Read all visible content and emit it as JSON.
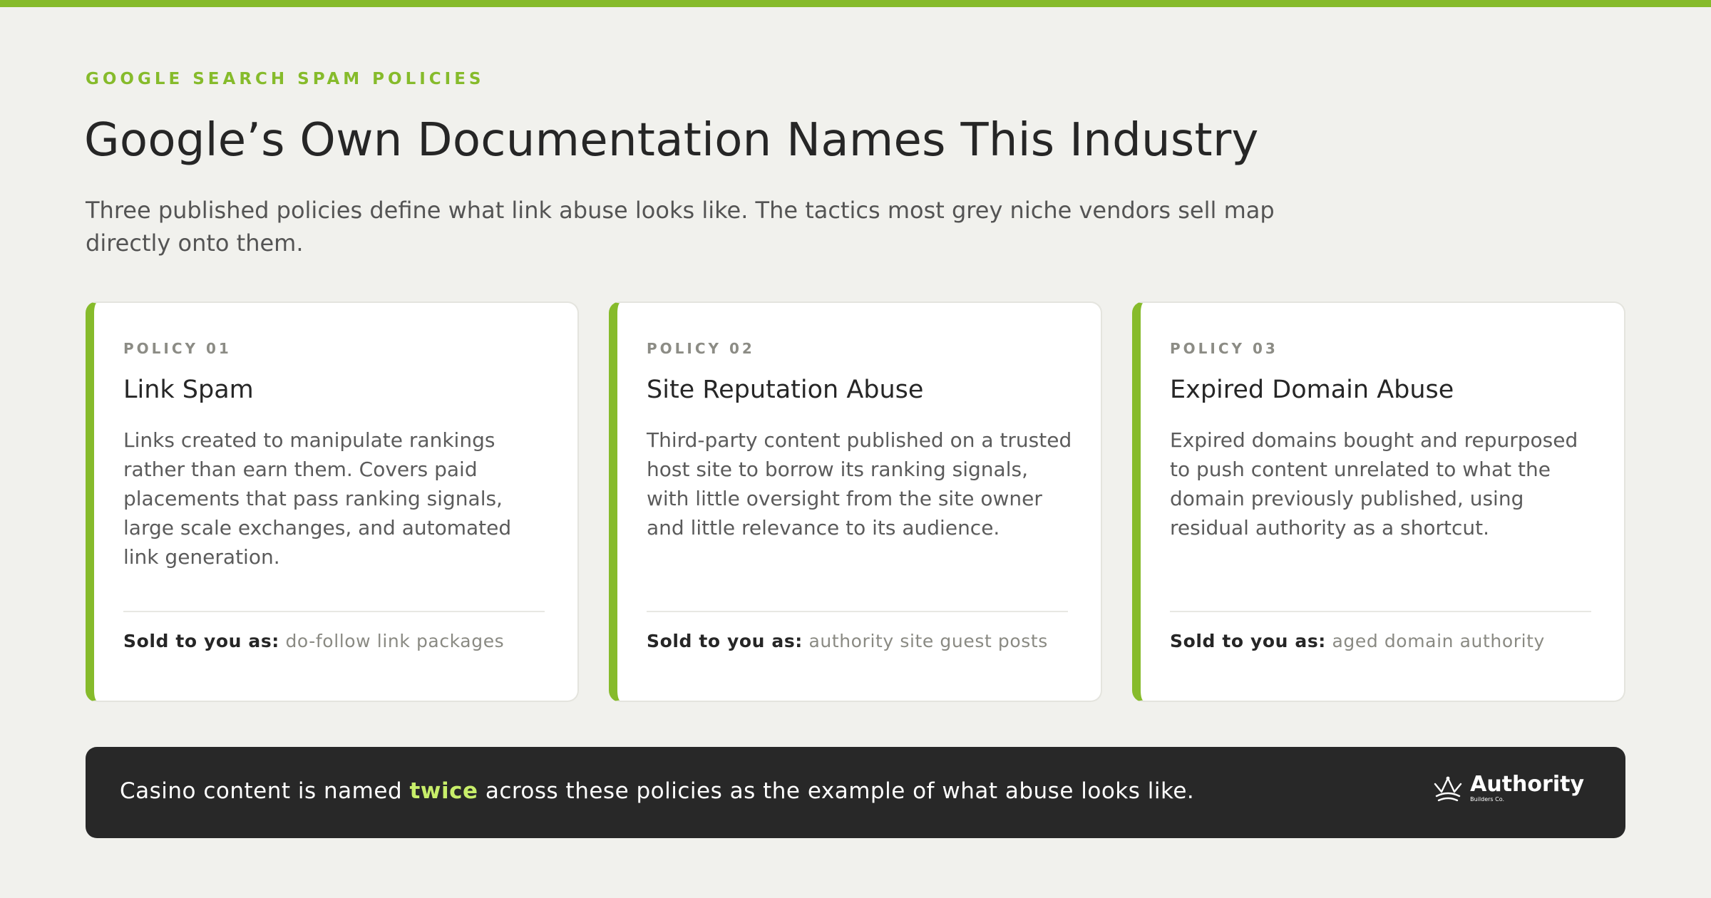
{
  "colors": {
    "accent": "#86bb2b",
    "background": "#f1f1ed",
    "banner_bg": "#282828",
    "highlight": "#c8ee6a"
  },
  "header": {
    "eyebrow": "GOOGLE SEARCH SPAM POLICIES",
    "title": "Google’s Own Documentation Names This Industry",
    "subtitle": "Three published policies define what link abuse looks like. The tactics most grey niche vendors sell map directly onto them."
  },
  "cards": [
    {
      "label": "POLICY 01",
      "title": "Link Spam",
      "description": "Links created to manipulate rankings rather than earn them. Covers paid placements that pass ranking signals, large scale exchanges, and automated link generation.",
      "sold_label": "Sold to you as:",
      "sold_value": "do-follow link packages"
    },
    {
      "label": "POLICY 02",
      "title": "Site Reputation Abuse",
      "description": "Third-party content published on a trusted host site to borrow its ranking signals, with little oversight from the site owner and little relevance to its audience.",
      "sold_label": "Sold to you as:",
      "sold_value": "authority site guest posts"
    },
    {
      "label": "POLICY 03",
      "title": "Expired Domain Abuse",
      "description": "Expired domains bought and repurposed to push content unrelated to what the domain previously published, using residual authority as a shortcut.",
      "sold_label": "Sold to you as:",
      "sold_value": "aged domain authority"
    }
  ],
  "banner": {
    "text_before": "Casino content is named ",
    "text_highlight": "twice",
    "text_after": " across these policies as the example of what abuse looks like.",
    "logo_name": "Authority",
    "logo_sub": "Builders Co.",
    "logo_icon": "crown-icon"
  }
}
